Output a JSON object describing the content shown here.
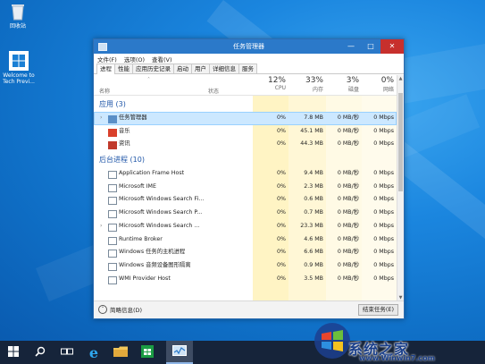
{
  "desktop": {
    "icons": [
      {
        "label": "回收站"
      },
      {
        "label": "Welcome to Tech Previ..."
      }
    ]
  },
  "window": {
    "title": "任务管理器",
    "menu": [
      "文件(F)",
      "选项(O)",
      "查看(V)"
    ],
    "tabs": [
      "进程",
      "性能",
      "应用历史记录",
      "启动",
      "用户",
      "详细信息",
      "服务"
    ],
    "active_tab": "进程",
    "columns": {
      "name": "名称",
      "status": "状态",
      "cpu": {
        "pct": "12%",
        "label": "CPU"
      },
      "memory": {
        "pct": "33%",
        "label": "内存"
      },
      "disk": {
        "pct": "3%",
        "label": "磁盘"
      },
      "network": {
        "pct": "0%",
        "label": "网络"
      }
    },
    "groups": [
      {
        "name": "应用 (3)",
        "rows": [
          {
            "name": "任务管理器",
            "cpu": "0%",
            "mem": "7.8 MB",
            "disk": "0 MB/秒",
            "net": "0 Mbps",
            "expandable": true,
            "selected": true
          },
          {
            "name": "音乐",
            "cpu": "0%",
            "mem": "45.1 MB",
            "disk": "0 MB/秒",
            "net": "0 Mbps",
            "expandable": false,
            "selected": false
          },
          {
            "name": "资讯",
            "cpu": "0%",
            "mem": "44.3 MB",
            "disk": "0 MB/秒",
            "net": "0 Mbps",
            "expandable": false,
            "selected": false
          }
        ]
      },
      {
        "name": "后台进程 (10)",
        "rows": [
          {
            "name": "Application Frame Host",
            "cpu": "0%",
            "mem": "9.4 MB",
            "disk": "0 MB/秒",
            "net": "0 Mbps",
            "expandable": false,
            "selected": false
          },
          {
            "name": "Microsoft IME",
            "cpu": "0%",
            "mem": "2.3 MB",
            "disk": "0 MB/秒",
            "net": "0 Mbps",
            "expandable": false,
            "selected": false
          },
          {
            "name": "Microsoft Windows Search Fi...",
            "cpu": "0%",
            "mem": "0.6 MB",
            "disk": "0 MB/秒",
            "net": "0 Mbps",
            "expandable": false,
            "selected": false
          },
          {
            "name": "Microsoft Windows Search P...",
            "cpu": "0%",
            "mem": "0.7 MB",
            "disk": "0 MB/秒",
            "net": "0 Mbps",
            "expandable": false,
            "selected": false
          },
          {
            "name": "Microsoft Windows Search ...",
            "cpu": "0%",
            "mem": "23.3 MB",
            "disk": "0 MB/秒",
            "net": "0 Mbps",
            "expandable": true,
            "selected": false
          },
          {
            "name": "Runtime Broker",
            "cpu": "0%",
            "mem": "4.6 MB",
            "disk": "0 MB/秒",
            "net": "0 Mbps",
            "expandable": false,
            "selected": false
          },
          {
            "name": "Windows 任务的主机进程",
            "cpu": "0%",
            "mem": "6.6 MB",
            "disk": "0 MB/秒",
            "net": "0 Mbps",
            "expandable": false,
            "selected": false
          },
          {
            "name": "Windows 音频设备图形隔离",
            "cpu": "0%",
            "mem": "0.9 MB",
            "disk": "0 MB/秒",
            "net": "0 Mbps",
            "expandable": false,
            "selected": false
          },
          {
            "name": "WMI Provider Host",
            "cpu": "0%",
            "mem": "3.5 MB",
            "disk": "0 MB/秒",
            "net": "0 Mbps",
            "expandable": false,
            "selected": false
          }
        ]
      }
    ],
    "footer": {
      "less_details": "简略信息(D)",
      "end_task": "结束任务(E)"
    }
  },
  "taskbar": {
    "items": [
      "start-icon",
      "search-icon",
      "task-view-icon",
      "internet-explorer-icon",
      "file-explorer-icon",
      "store-icon",
      "task-manager-icon"
    ]
  },
  "watermark": {
    "text": "系统之家",
    "url": "www.Winwin7.com",
    "logo_letters": "Win7"
  }
}
